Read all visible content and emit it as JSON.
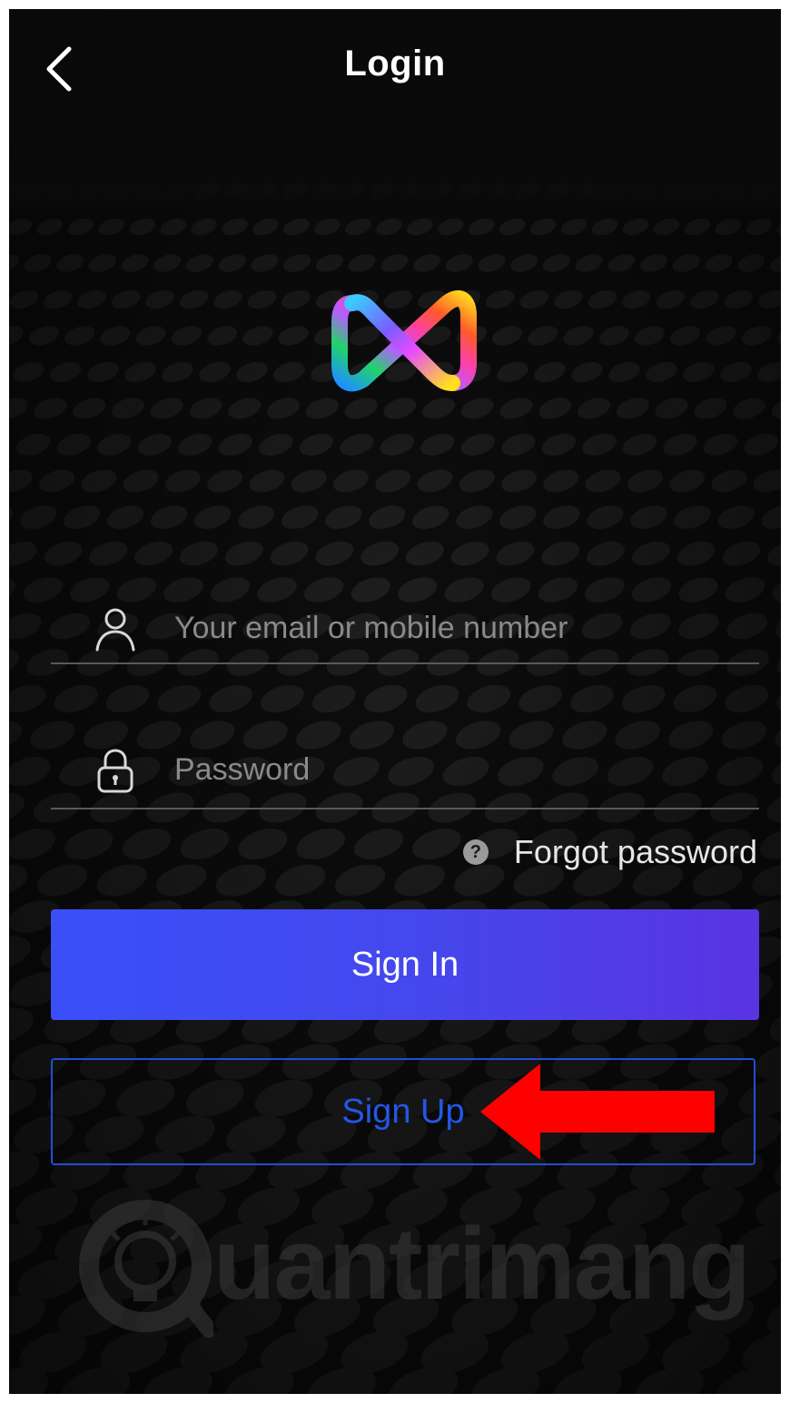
{
  "header": {
    "title": "Login"
  },
  "form": {
    "email_placeholder": "Your email or mobile number",
    "email_value": "",
    "password_placeholder": "Password",
    "password_value": "",
    "forgot_password_label": "Forgot password"
  },
  "buttons": {
    "sign_in_label": "Sign In",
    "sign_up_label": "Sign Up"
  },
  "watermark": {
    "text": "uantrimang"
  },
  "icons": {
    "back": "back-chevron-icon",
    "user": "user-icon",
    "lock": "lock-icon",
    "help": "question-circle-icon",
    "logo": "infinity-logo",
    "annotation": "red-arrow-annotation"
  },
  "colors": {
    "background": "#0d0d0d",
    "sign_in_gradient_start": "#3a4ff8",
    "sign_in_gradient_end": "#5a33e2",
    "sign_up_accent": "#2457e6",
    "annotation_red": "#ff0000"
  }
}
